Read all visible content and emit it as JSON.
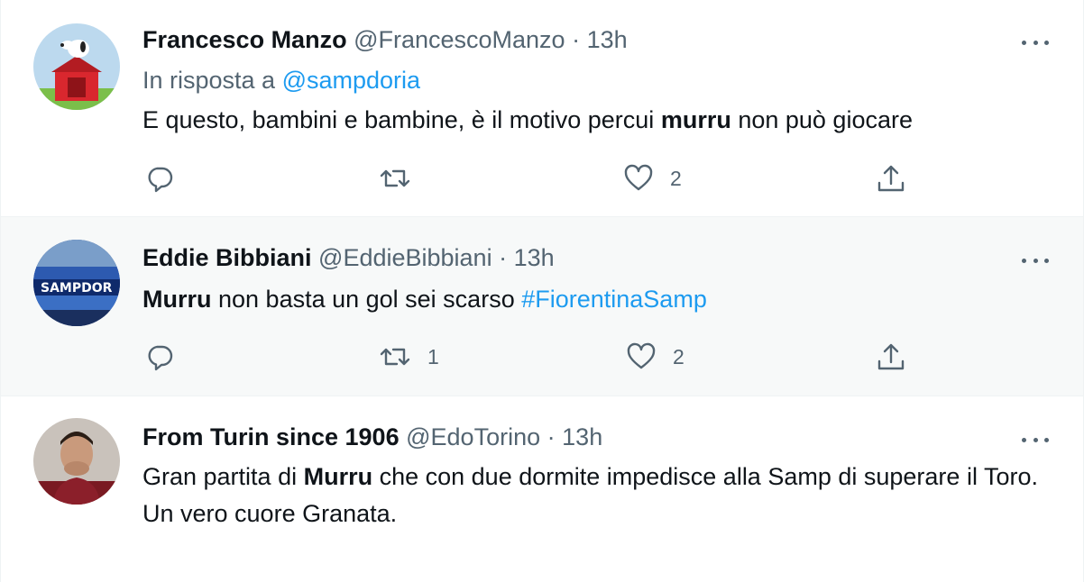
{
  "colors": {
    "text": "#0f1419",
    "secondary": "#536471",
    "link": "#1d9bf0",
    "highlight_bg": "#f7f9f9"
  },
  "tweets": [
    {
      "name": "Francesco Manzo",
      "handle": "@FrancescoManzo",
      "sep": "·",
      "time": "13h",
      "reply_prefix": "In risposta a",
      "reply_to": "@sampdoria",
      "text_1": "E questo, bambini e bambine, è il motivo percui ",
      "text_bold": "murru",
      "text_2": " non può giocare",
      "replies": "",
      "retweets": "",
      "likes": "2",
      "icons": [
        "reply-icon",
        "retweet-icon",
        "like-icon",
        "share-icon",
        "more-icon"
      ]
    },
    {
      "name": "Eddie Bibbiani",
      "handle": "@EddieBibbiani",
      "sep": "·",
      "time": "13h",
      "text_bold": "Murru",
      "text_1": " non basta un gol sei scarso ",
      "hashtag": "#FiorentinaSamp",
      "replies": "",
      "retweets": "1",
      "likes": "2",
      "icons": [
        "reply-icon",
        "retweet-icon",
        "like-icon",
        "share-icon",
        "more-icon"
      ]
    },
    {
      "name": "From Turin since 1906",
      "handle": "@EdoTorino",
      "sep": "·",
      "time": "13h",
      "text_1": "Gran partita di ",
      "text_bold": "Murru",
      "text_2": " che con due dormite impedisce alla Samp di superare il Toro.",
      "text_3": "Un vero cuore Granata.",
      "icons": [
        "more-icon"
      ]
    }
  ]
}
